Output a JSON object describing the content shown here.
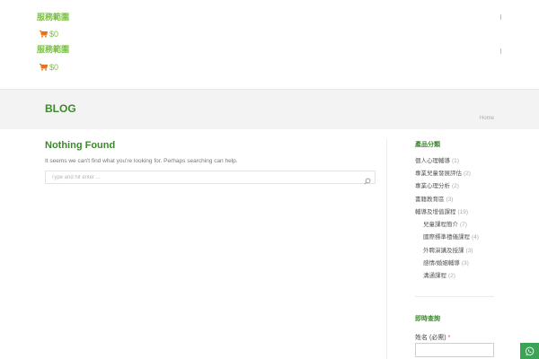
{
  "header": {
    "menu_label": "服務範圍",
    "cart_amount": "$0"
  },
  "page": {
    "title": "BLOG",
    "breadcrumb_home": "Home"
  },
  "main": {
    "heading": "Nothing Found",
    "message": "It seems we can't find what you're looking for. Perhaps searching can help.",
    "search_placeholder": "Type and hit enter ..."
  },
  "sidebar": {
    "categories_title": "產品分類",
    "categories": [
      {
        "label": "個人心理輔導",
        "count": "(1)"
      },
      {
        "label": "專業兒童發展評估",
        "count": "(2)"
      },
      {
        "label": "專業心理分析",
        "count": "(2)"
      },
      {
        "label": "書籍教育區",
        "count": "(3)"
      },
      {
        "label": "輔導及增值課程",
        "count": "(19)"
      },
      {
        "label": "兒童課程簡介",
        "count": "(7)"
      },
      {
        "label": "國際標準禮儀課程",
        "count": "(4)"
      },
      {
        "label": "外聘演講及授課",
        "count": "(3)"
      },
      {
        "label": "感情/婚姻輔導",
        "count": "(3)"
      },
      {
        "label": "溝通課程",
        "count": "(2)"
      }
    ],
    "enquiry_title": "即時查詢",
    "name_label": "姓名 (必需)",
    "required_mark": "*"
  },
  "colors": {
    "brand_green": "#7ac143",
    "heading_green": "#3b8a2a",
    "cart_orange": "#e8731a",
    "whatsapp_green": "#3ea455"
  },
  "icons": {
    "cart": "shopping-cart-icon",
    "search": "search-icon",
    "whatsapp": "whatsapp-icon"
  }
}
